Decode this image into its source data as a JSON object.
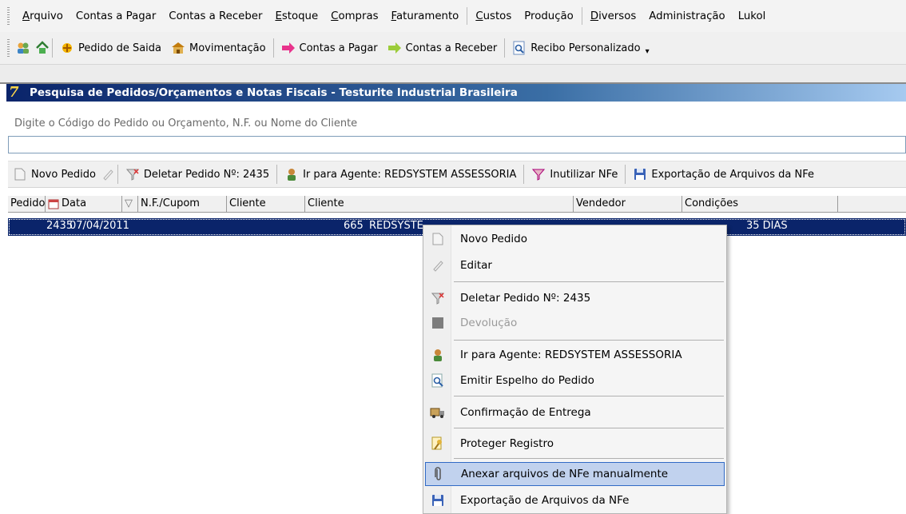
{
  "menu": [
    "Arquivo",
    "Contas a Pagar",
    "Contas a Receber",
    "Estoque",
    "Compras",
    "Faturamento",
    "Custos",
    "Produção",
    "Diversos",
    "Administração",
    "Lukol"
  ],
  "toolbar": {
    "pedido_saida": "Pedido de Saida",
    "movimentacao": "Movimentação",
    "contas_pagar": "Contas a Pagar",
    "contas_receber": "Contas a Receber",
    "recibo": "Recibo Personalizado"
  },
  "window": {
    "title": "Pesquisa de Pedidos/Orçamentos e Notas Fiscais - Testurite Industrial Brasileira",
    "logo": "7"
  },
  "search": {
    "label": "Digite o Código do Pedido ou Orçamento, N.F. ou Nome do Cliente",
    "value": ""
  },
  "actions": {
    "novo": "Novo Pedido",
    "deletar": "Deletar Pedido Nº: 2435",
    "agente": "Ir para Agente: REDSYSTEM ASSESSORIA",
    "inutilizar": "Inutilizar NFe",
    "exportacao": "Exportação de Arquivos da NFe"
  },
  "grid": {
    "headers": [
      "Pedido",
      "Data",
      "N.F./Cupom",
      "Cliente",
      "Cliente",
      "Vendedor",
      "Condições"
    ],
    "rows": [
      {
        "pedido": "2435",
        "data": "07/04/2011",
        "cliente_cod": "665",
        "cliente": "REDSYSTEM ASSESSORIA DE",
        "condicoes": "35 DIAS"
      }
    ]
  },
  "context_menu": {
    "novo": "Novo Pedido",
    "editar": "Editar",
    "deletar": "Deletar Pedido Nº: 2435",
    "devolucao": "Devolução",
    "agente": "Ir para Agente: REDSYSTEM ASSESSORIA",
    "espelho": "Emitir Espelho do Pedido",
    "entrega": "Confirmação de Entrega",
    "proteger": "Proteger Registro",
    "anexar": "Anexar arquivos de NFe manualmente",
    "exportacao": "Exportação de Arquivos da NFe"
  }
}
